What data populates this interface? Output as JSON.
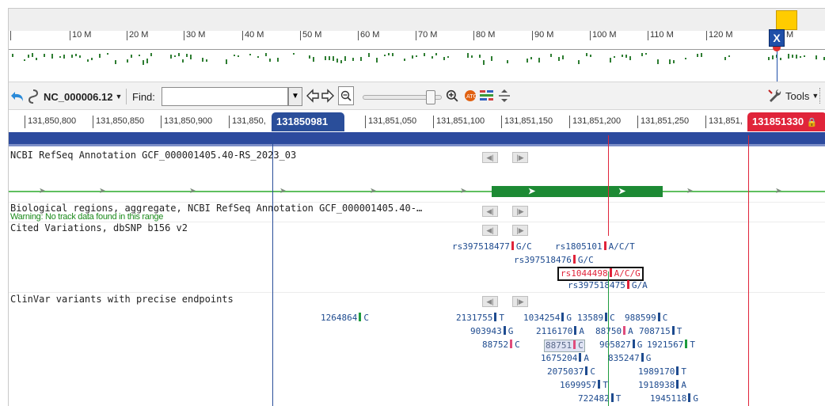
{
  "overview": {
    "ticks": [
      "10 M",
      "20 M",
      "30 M",
      "40 M",
      "50 M",
      "60 M",
      "70 M",
      "80 M",
      "90 M",
      "100 M",
      "110 M",
      "120 M",
      "M"
    ],
    "cursor_label": "X"
  },
  "toolbar": {
    "accession": "NC_000006.12",
    "find_label": "Find:",
    "find_value": "",
    "tools_label": "Tools"
  },
  "ruler": {
    "ticks": [
      "131,850,800",
      "131,850,850",
      "131,850,900",
      "131,850,",
      "131,851,050",
      "131,851,100",
      "131,851,150",
      "131,851,200",
      "131,851,250",
      "131,851,"
    ],
    "marker_left": "131850981",
    "marker_right": "131851330"
  },
  "tracks": {
    "refseq": "NCBI RefSeq Annotation GCF_000001405.40-RS_2023_03",
    "bio_regions": "Biological regions, aggregate, NCBI RefSeq Annotation GCF_000001405.40-…",
    "warning": "Warning: No track data found in this range",
    "cited": "Cited Variations, dbSNP b156 v2",
    "clinvar": "ClinVar variants with precise endpoints"
  },
  "cited_variants": [
    {
      "id": "rs397518477",
      "allele": "G/C",
      "color": "red"
    },
    {
      "id": "rs1805101",
      "allele": "A/C/T",
      "color": "red"
    },
    {
      "id": "rs397518476",
      "allele": "G/C",
      "color": "red"
    },
    {
      "id": "rs1044498",
      "allele": "A/C/G",
      "color": "red",
      "selected": true
    },
    {
      "id": "rs397518475",
      "allele": "G/A",
      "color": "red"
    }
  ],
  "clinvar_variants": [
    {
      "id": "1264864",
      "allele": "C",
      "color": "green"
    },
    {
      "id": "2131755",
      "allele": "T",
      "color": "blue"
    },
    {
      "id": "1034254",
      "allele": "G",
      "color": "blue"
    },
    {
      "id": "13589",
      "allele": "C",
      "color": "blue"
    },
    {
      "id": "988599",
      "allele": "C",
      "color": "blue"
    },
    {
      "id": "903943",
      "allele": "G",
      "color": "blue"
    },
    {
      "id": "2116170",
      "allele": "A",
      "color": "blue"
    },
    {
      "id": "88750",
      "allele": "A",
      "color": "pink"
    },
    {
      "id": "708715",
      "allele": "T",
      "color": "blue"
    },
    {
      "id": "88752",
      "allele": "C",
      "color": "pink"
    },
    {
      "id": "88751",
      "allele": "C",
      "color": "pink",
      "highlight": true
    },
    {
      "id": "905827",
      "allele": "G",
      "color": "blue"
    },
    {
      "id": "1921567",
      "allele": "T",
      "color": "green"
    },
    {
      "id": "1675204",
      "allele": "A",
      "color": "blue"
    },
    {
      "id": "835247",
      "allele": "G",
      "color": "blue"
    },
    {
      "id": "2075037",
      "allele": "C",
      "color": "blue"
    },
    {
      "id": "1989170",
      "allele": "T",
      "color": "blue"
    },
    {
      "id": "1699957",
      "allele": "T",
      "color": "blue"
    },
    {
      "id": "1918938",
      "allele": "A",
      "color": "blue"
    },
    {
      "id": "722482",
      "allele": "T",
      "color": "blue"
    },
    {
      "id": "1945118",
      "allele": "G",
      "color": "blue"
    }
  ]
}
